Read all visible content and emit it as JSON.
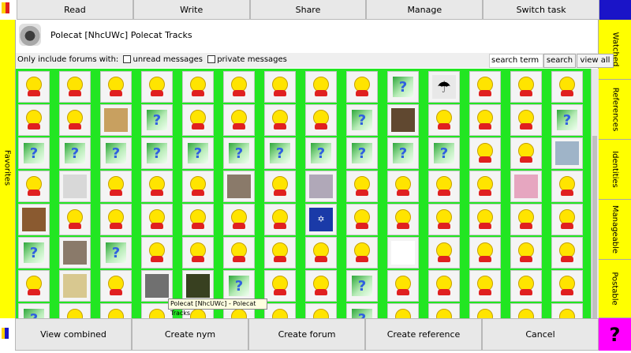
{
  "top_tabs": [
    "Read",
    "Write",
    "Share",
    "Manage",
    "Switch task"
  ],
  "left_tab": "Favorites",
  "right_tabs": [
    "Watched",
    "References",
    "Identities",
    "Manageable",
    "Postable"
  ],
  "forum_header": {
    "title": "Polecat [NhcUWc] Polecat Tracks"
  },
  "filter": {
    "label": "Only include forums with:",
    "unread_label": "unread messages",
    "private_label": "private messages",
    "search_value": "search term",
    "search_button": "search",
    "view_all_button": "view all"
  },
  "tooltip": "Polecat [NhcUWc] - Polecat Tracks",
  "bottom_buttons": [
    "View combined",
    "Create nym",
    "Create forum",
    "Create reference",
    "Cancel"
  ],
  "help_label": "?",
  "grid_rows": [
    [
      "smiley",
      "smiley",
      "smiley",
      "smiley",
      "smiley",
      "smiley",
      "smiley",
      "smiley",
      "smiley",
      "question",
      "umbrella",
      "smiley",
      "smiley",
      "smiley"
    ],
    [
      "smiley",
      "smiley",
      "spam",
      "question",
      "smiley",
      "smiley",
      "smiley",
      "smiley",
      "question",
      "building",
      "smiley",
      "smiley",
      "smiley",
      "question"
    ],
    [
      "question",
      "question",
      "question",
      "question",
      "question",
      "question",
      "question",
      "question",
      "question",
      "question",
      "question",
      "smiley",
      "smiley",
      "logo"
    ],
    [
      "smiley",
      "window",
      "smiley",
      "smiley",
      "smiley",
      "photo",
      "smiley",
      "robot",
      "smiley",
      "smiley",
      "smiley",
      "smiley",
      "pink",
      "smiley"
    ],
    [
      "anime",
      "smiley",
      "smiley",
      "smiley",
      "smiley",
      "smiley",
      "smiley",
      "star",
      "smiley",
      "smiley",
      "smiley",
      "smiley",
      "smiley",
      "smiley"
    ],
    [
      "question",
      "photo",
      "question",
      "smiley",
      "smiley",
      "smiley",
      "smiley",
      "smiley",
      "smiley",
      "nicky",
      "smiley",
      "smiley",
      "smiley",
      "smiley"
    ],
    [
      "smiley",
      "stamp",
      "smiley",
      "ferret",
      "portrait",
      "question",
      "smiley",
      "smiley",
      "question",
      "smiley",
      "smiley",
      "smiley",
      "smiley",
      "smiley"
    ],
    [
      "question",
      "smiley",
      "smiley",
      "smiley",
      "smiley",
      "smiley",
      "smiley",
      "smiley",
      "question",
      "smiley",
      "smiley",
      "smiley",
      "smiley",
      "smiley"
    ]
  ]
}
